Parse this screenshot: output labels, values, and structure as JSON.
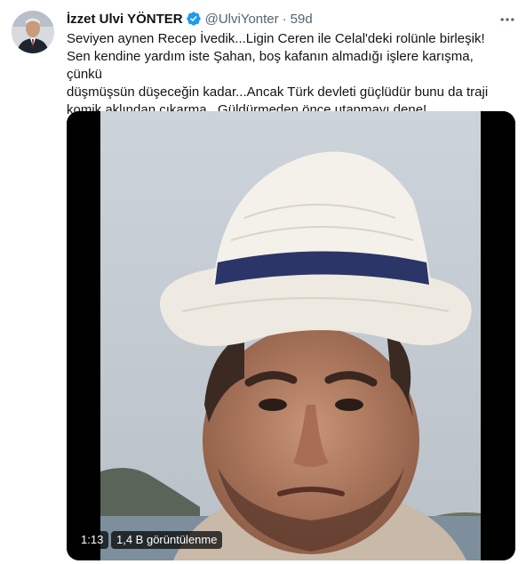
{
  "tweet": {
    "author_name": "İzzet Ulvi YÖNTER",
    "handle": "@UlviYonter",
    "separator": "·",
    "time": "59d",
    "more_icon": "more-dots-icon",
    "verified_icon": "verified-badge-icon",
    "text_lines": [
      "Seviyen aynen Recep İvedik...Ligin Ceren ile Celal'deki rolünle birleşik!",
      "Sen kendine yardım iste Şahan, boş kafanın almadığı işlere karışma, çünkü",
      "düşmüşsün düşeceğin kadar...Ancak Türk devleti güçlüdür bunu da traji",
      "komik aklından çıkarma...Güldürmeden önce utanmayı dene!"
    ]
  },
  "video": {
    "duration": "1:13",
    "views": "1,4 B görüntülenme"
  },
  "colors": {
    "text": "#0f1419",
    "secondary": "#536471",
    "verified": "#1d9bf0"
  }
}
